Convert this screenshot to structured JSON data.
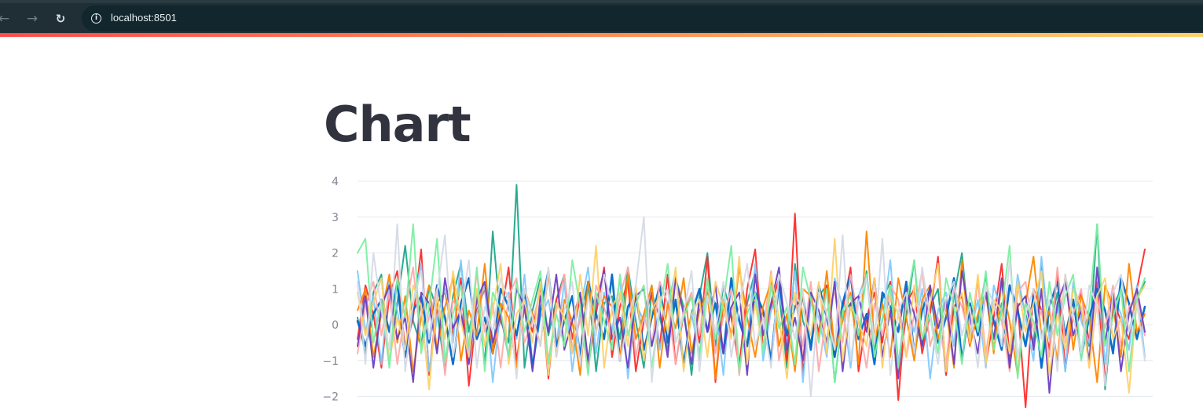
{
  "browser": {
    "back_icon": "←",
    "forward_icon": "→",
    "reload_icon": "↻",
    "info_icon": "i",
    "url": "localhost:8501"
  },
  "page": {
    "title": "Chart"
  },
  "chart_data": {
    "type": "line",
    "ylim": [
      -2.2,
      4.1
    ],
    "yticks": [
      4,
      3,
      2,
      1,
      0,
      -1,
      -2
    ],
    "yticks_labels": [
      "4",
      "3",
      "2",
      "1",
      "0",
      "−1",
      "−2"
    ],
    "grid": true,
    "legend": "none",
    "points_per_series": 100,
    "series": [
      {
        "color": "#1fa78a",
        "values": [
          0.2,
          -0.8,
          0.9,
          1.4,
          -1.1,
          0.6,
          2.2,
          0.1,
          -0.6,
          1.1,
          0.4,
          -1.3,
          0.8,
          1.7,
          -0.2,
          0.9,
          -1.1,
          2.6,
          0.1,
          -0.5,
          3.9,
          -1.2,
          0.4,
          1.3,
          -0.3,
          0.7,
          1.4,
          -0.8,
          0.2,
          1.2,
          -1.3,
          0.6,
          0.8,
          -0.4,
          1.6,
          0.1,
          -1.2,
          0.9,
          0.2,
          -0.7,
          1.3,
          0.5,
          -1.4,
          0.8,
          2.0,
          -0.6,
          1.1,
          0.3,
          -1.1,
          0.6,
          1.5,
          -0.3,
          0.4,
          0.9,
          -1.2,
          1.7,
          0.1,
          -0.5,
          0.8,
          1.1,
          -1.6,
          0.3,
          0.6,
          -0.4,
          1.5,
          -0.8,
          0.7,
          1.2,
          -1.1,
          0.2,
          1.8,
          -0.6,
          0.5,
          1.0,
          -1.4,
          0.8,
          2.0,
          -0.3,
          0.1,
          1.4,
          -0.7,
          0.6,
          -1.1,
          1.2,
          0.3,
          -0.5,
          1.7,
          -0.2,
          0.9,
          -1.3,
          1.1,
          0.4,
          -0.6,
          2.8,
          -1.8,
          0.5,
          1.0,
          -0.2,
          0.7,
          1.2
        ]
      },
      {
        "color": "#ff2b2b",
        "values": [
          -0.4,
          1.1,
          0.3,
          -1.2,
          0.8,
          1.5,
          -0.7,
          0.2,
          2.1,
          -1.4,
          0.6,
          0.9,
          -0.3,
          1.3,
          -1.7,
          0.4,
          1.0,
          -0.8,
          0.2,
          1.6,
          -1.0,
          0.5,
          -0.2,
          1.1,
          -1.5,
          0.7,
          1.3,
          -0.4,
          0.8,
          -1.2,
          0.3,
          1.6,
          -0.9,
          0.5,
          1.2,
          -1.3,
          0.1,
          0.9,
          -0.6,
          1.4,
          -1.1,
          0.3,
          0.8,
          -0.5,
          1.9,
          -1.6,
          0.6,
          0.2,
          -1.2,
          1.0,
          2.1,
          -0.7,
          0.5,
          1.3,
          -1.0,
          3.1,
          -1.4,
          0.7,
          -0.2,
          1.1,
          -0.9,
          0.4,
          1.6,
          -1.3,
          0.2,
          0.9,
          -0.5,
          1.2,
          -2.1,
          0.6,
          1.0,
          -0.8,
          0.3,
          1.9,
          -1.4,
          0.5,
          0.8,
          -0.6,
          1.3,
          -1.1,
          0.2,
          1.7,
          -0.9,
          0.6,
          -2.3,
          1.0,
          0.4,
          -0.7,
          1.5,
          -1.2,
          0.3,
          0.9,
          -0.5,
          1.2,
          -1.6,
          0.7,
          0.1,
          -0.4,
          1.0,
          2.1
        ]
      },
      {
        "color": "#83c9ff",
        "values": [
          1.5,
          -0.2,
          0.8,
          -1.1,
          1.3,
          0.4,
          -0.9,
          0.6,
          1.7,
          -1.3,
          0.2,
          1.0,
          -0.5,
          1.8,
          -0.8,
          0.3,
          1.1,
          -1.6,
          0.5,
          0.9,
          -0.4,
          1.4,
          -1.1,
          0.2,
          0.7,
          -0.6,
          1.2,
          -1.3,
          0.4,
          1.6,
          -0.8,
          0.9,
          -0.2,
          1.3,
          -1.5,
          0.6,
          0.1,
          1.1,
          -0.7,
          0.5,
          1.5,
          -1.2,
          0.3,
          -0.8,
          1.0,
          0.6,
          -1.4,
          1.2,
          0.2,
          -0.5,
          1.7,
          -1.0,
          0.4,
          0.9,
          -0.3,
          1.5,
          -1.6,
          0.7,
          0.2,
          -0.9,
          1.3,
          0.5,
          -1.2,
          0.8,
          1.4,
          -0.4,
          0.1,
          1.8,
          -1.1,
          0.6,
          -0.2,
          1.0,
          -1.5,
          0.4,
          0.9,
          -0.6,
          1.6,
          -0.3,
          0.7,
          -1.2,
          1.1,
          0.3,
          -0.8,
          1.4,
          0.2,
          -1.0,
          1.9,
          -0.4,
          0.6,
          -1.3,
          1.2,
          0.1,
          -0.5,
          1.5,
          -1.1,
          0.8,
          0.3,
          -0.7,
          1.1,
          -0.9
        ]
      },
      {
        "color": "#0068c9",
        "values": [
          0.1,
          -0.6,
          0.3,
          0.7,
          -0.2,
          1.2,
          -0.9,
          0.4,
          0.8,
          -0.5,
          1.1,
          0.2,
          -1.1,
          0.6,
          1.3,
          -0.4,
          0.2,
          -0.8,
          1.0,
          0.5,
          -0.3,
          0.9,
          -1.2,
          0.4,
          1.5,
          -0.6,
          0.1,
          0.8,
          -0.9,
          1.2,
          0.3,
          -0.4,
          1.4,
          -1.0,
          0.5,
          0.9,
          -0.7,
          0.2,
          1.1,
          -0.5,
          0.7,
          -1.1,
          0.3,
          1.0,
          -0.2,
          0.6,
          -0.8,
          1.3,
          0.1,
          -0.6,
          0.9,
          0.4,
          -1.0,
          1.2,
          -0.3,
          0.5,
          0.8,
          -0.7,
          1.1,
          0.2,
          -0.9,
          0.6,
          1.4,
          -0.4,
          0.3,
          -1.1,
          0.9,
          0.5,
          -0.2,
          1.2,
          -0.8,
          0.4,
          1.0,
          -0.5,
          0.2,
          1.3,
          -1.0,
          0.6,
          -0.3,
          0.9,
          0.1,
          -0.7,
          1.1,
          0.4,
          -0.6,
          0.8,
          -1.2,
          0.5,
          1.2,
          -0.3,
          0.7,
          -0.9,
          0.2,
          1.0,
          0.4,
          -0.8,
          1.3,
          0.6,
          -0.4,
          0.5
        ]
      },
      {
        "color": "#ffabab",
        "values": [
          -0.8,
          0.5,
          1.2,
          -0.3,
          0.9,
          -1.1,
          0.4,
          1.6,
          -0.6,
          0.2,
          1.0,
          -1.4,
          0.7,
          0.3,
          -0.9,
          1.5,
          -0.2,
          0.6,
          -1.2,
          0.8,
          1.3,
          -0.5,
          0.1,
          0.9,
          -1.0,
          0.4,
          1.4,
          -0.7,
          0.2,
          -1.3,
          1.1,
          0.5,
          -0.4,
          0.8,
          1.6,
          -0.9,
          0.3,
          -0.6,
          1.2,
          0.6,
          -1.1,
          0.4,
          0.9,
          -0.3,
          1.3,
          -0.8,
          0.2,
          1.0,
          -1.4,
          0.5,
          0.7,
          -0.2,
          1.5,
          -1.0,
          0.3,
          0.8,
          -0.6,
          1.2,
          -1.3,
          0.4,
          0.9,
          -0.5,
          1.4,
          0.1,
          -1.2,
          0.6,
          -0.3,
          1.1,
          0.7,
          -0.9,
          0.3,
          1.5,
          -0.6,
          0.2,
          -1.1,
          1.0,
          0.5,
          -0.4,
          1.3,
          -0.8,
          0.6,
          0.1,
          -1.3,
          0.9,
          1.2,
          -0.2,
          0.4,
          -0.9,
          1.6,
          -0.5,
          0.3,
          1.0,
          -1.2,
          0.7,
          -0.1,
          1.1,
          -0.6,
          0.5,
          0.8,
          -0.3
        ]
      },
      {
        "color": "#ff8700",
        "values": [
          0.4,
          1.0,
          -0.9,
          0.3,
          1.4,
          -0.5,
          0.8,
          -1.3,
          0.2,
          1.1,
          -0.7,
          0.5,
          1.3,
          -1.0,
          0.4,
          -0.3,
          1.7,
          -0.8,
          0.6,
          0.2,
          -1.2,
          1.0,
          0.3,
          -0.6,
          1.5,
          -0.9,
          0.7,
          0.1,
          -1.4,
          1.2,
          -0.2,
          0.8,
          0.5,
          -1.0,
          1.4,
          -0.4,
          0.3,
          1.1,
          -1.2,
          0.6,
          -0.1,
          1.3,
          -0.8,
          0.4,
          0.9,
          -1.5,
          0.7,
          -0.3,
          1.6,
          0.2,
          -0.9,
          0.5,
          1.2,
          -0.6,
          0.3,
          -1.3,
          1.0,
          0.8,
          -0.4,
          1.5,
          -0.7,
          0.1,
          0.9,
          -1.1,
          2.6,
          -0.5,
          0.6,
          -0.9,
          1.3,
          0.2,
          -1.0,
          0.7,
          1.1,
          -0.4,
          0.5,
          -1.2,
          1.8,
          -0.6,
          0.3,
          0.9,
          -0.8,
          1.2,
          0.1,
          -1.4,
          0.6,
          1.9,
          -0.3,
          0.4,
          -1.0,
          1.4,
          -0.7,
          0.8,
          0.2,
          -1.6,
          1.1,
          0.5,
          -0.9,
          1.7,
          -0.2,
          0.3
        ]
      },
      {
        "color": "#6d3fc0",
        "values": [
          -0.6,
          0.8,
          -1.2,
          0.5,
          1.1,
          -0.4,
          0.2,
          -1.6,
          0.9,
          0.6,
          -0.8,
          1.3,
          -0.1,
          0.4,
          -1.1,
          0.7,
          1.2,
          -0.5,
          0.3,
          -0.9,
          1.0,
          0.5,
          -1.3,
          0.8,
          -0.2,
          1.4,
          -0.7,
          0.1,
          0.9,
          -1.0,
          0.6,
          1.5,
          -0.4,
          0.2,
          -1.2,
          0.8,
          1.0,
          -0.6,
          0.4,
          -0.9,
          1.3,
          0.3,
          -1.1,
          0.7,
          -0.2,
          1.1,
          -0.8,
          0.5,
          0.9,
          -1.4,
          1.4,
          -0.3,
          0.6,
          1.6,
          -0.7,
          0.2,
          -1.0,
          0.9,
          0.4,
          -0.5,
          1.2,
          -1.3,
          0.6,
          0.8,
          -0.2,
          1.3,
          -0.9,
          0.4,
          -1.5,
          1.0,
          0.3,
          -0.6,
          1.1,
          -0.1,
          0.7,
          -1.1,
          1.5,
          0.2,
          -0.8,
          0.9,
          -0.4,
          1.3,
          -1.2,
          0.5,
          0.8,
          -0.7,
          1.0,
          -1.9,
          0.6,
          1.2,
          -0.3,
          0.4,
          -1.0,
          1.6,
          -0.5,
          0.9,
          -1.3,
          0.3,
          1.0,
          -0.2
        ]
      },
      {
        "color": "#ffd16a",
        "values": [
          0.9,
          -0.3,
          0.6,
          1.3,
          -1.0,
          0.2,
          -0.7,
          1.1,
          0.5,
          -1.8,
          0.8,
          -0.4,
          1.5,
          0.1,
          -0.9,
          1.0,
          -0.6,
          0.4,
          1.7,
          -1.1,
          0.3,
          0.7,
          -0.5,
          1.2,
          -1.4,
          0.6,
          0.2,
          -0.8,
          1.4,
          -0.3,
          2.2,
          -1.2,
          0.5,
          0.9,
          -0.6,
          1.1,
          -1.0,
          0.4,
          0.8,
          -0.2,
          1.6,
          -1.3,
          0.3,
          0.7,
          -0.9,
          1.2,
          0.5,
          -0.4,
          1.9,
          -1.1,
          0.6,
          -0.7,
          1.4,
          0.2,
          -1.5,
          0.9,
          0.4,
          -0.3,
          1.2,
          -0.8,
          2.4,
          -1.0,
          0.5,
          0.1,
          -0.6,
          1.3,
          -1.2,
          0.8,
          0.3,
          -0.9,
          1.1,
          -0.4,
          0.6,
          1.7,
          -1.3,
          0.2,
          0.9,
          -0.5,
          1.4,
          -1.1,
          0.7,
          0.4,
          -0.8,
          1.2,
          -0.2,
          0.6,
          1.5,
          -1.4,
          0.3,
          -0.7,
          1.0,
          0.5,
          -1.2,
          0.8,
          1.3,
          -0.4,
          0.2,
          -1.9,
          0.7,
          1.1
        ]
      },
      {
        "color": "#7defa1",
        "values": [
          2.0,
          2.4,
          -0.5,
          0.7,
          -1.2,
          1.3,
          0.2,
          2.8,
          -0.8,
          0.5,
          2.4,
          -1.0,
          0.3,
          1.1,
          -0.6,
          1.6,
          -1.3,
          0.9,
          0.4,
          -0.9,
          1.2,
          -0.2,
          0.7,
          1.5,
          -1.1,
          0.3,
          -0.6,
          1.8,
          0.5,
          -1.4,
          0.9,
          0.1,
          -0.7,
          1.4,
          -0.3,
          0.6,
          1.1,
          -1.2,
          0.4,
          1.7,
          -0.5,
          0.2,
          0.8,
          -1.0,
          1.3,
          -0.4,
          0.6,
          2.2,
          -1.3,
          0.3,
          0.9,
          -0.8,
          1.1,
          -0.1,
          0.5,
          -1.1,
          1.6,
          0.7,
          -0.5,
          1.0,
          -1.6,
          0.4,
          0.8,
          -0.3,
          1.4,
          -0.9,
          0.2,
          1.1,
          -1.2,
          0.6,
          1.8,
          -0.4,
          0.3,
          -0.8,
          1.3,
          0.5,
          -1.1,
          0.9,
          -0.2,
          1.5,
          -0.7,
          0.4,
          2.2,
          -1.5,
          0.6,
          0.1,
          -0.9,
          1.2,
          -0.3,
          0.8,
          1.4,
          -1.0,
          0.5,
          2.8,
          -0.6,
          0.2,
          1.0,
          -1.3,
          0.7,
          1.3
        ]
      },
      {
        "color": "#d5dae5",
        "values": [
          1.2,
          -1.1,
          2.0,
          0.4,
          -0.7,
          2.8,
          -1.3,
          0.6,
          1.5,
          -0.4,
          0.9,
          2.5,
          -0.9,
          0.3,
          1.8,
          -1.2,
          0.5,
          -0.2,
          1.3,
          0.7,
          -1.5,
          1.0,
          0.2,
          -0.6,
          1.6,
          -0.9,
          0.4,
          1.2,
          -1.1,
          0.8,
          -0.3,
          1.4,
          0.6,
          -1.0,
          0.1,
          1.1,
          3.0,
          -1.6,
          0.7,
          1.0,
          -0.5,
          0.3,
          1.5,
          -1.3,
          0.8,
          -0.2,
          1.2,
          -0.9,
          0.5,
          1.7,
          -0.6,
          0.2,
          -1.2,
          1.4,
          0.6,
          -0.4,
          1.0,
          -2.0,
          0.9,
          0.3,
          -0.7,
          2.5,
          -1.0,
          0.6,
          1.3,
          -0.5,
          2.4,
          -1.4,
          0.4,
          0.9,
          -0.8,
          1.6,
          0.2,
          -1.1,
          0.7,
          1.2,
          -0.3,
          0.5,
          -1.2,
          1.1,
          0.6,
          -0.6,
          1.8,
          -0.9,
          0.3,
          1.0,
          -0.4,
          0.7,
          -1.3,
          1.4,
          0.2,
          -0.8,
          1.1,
          0.5,
          -1.7,
          0.9,
          1.4,
          -0.2,
          0.6,
          -1.0
        ]
      }
    ]
  }
}
